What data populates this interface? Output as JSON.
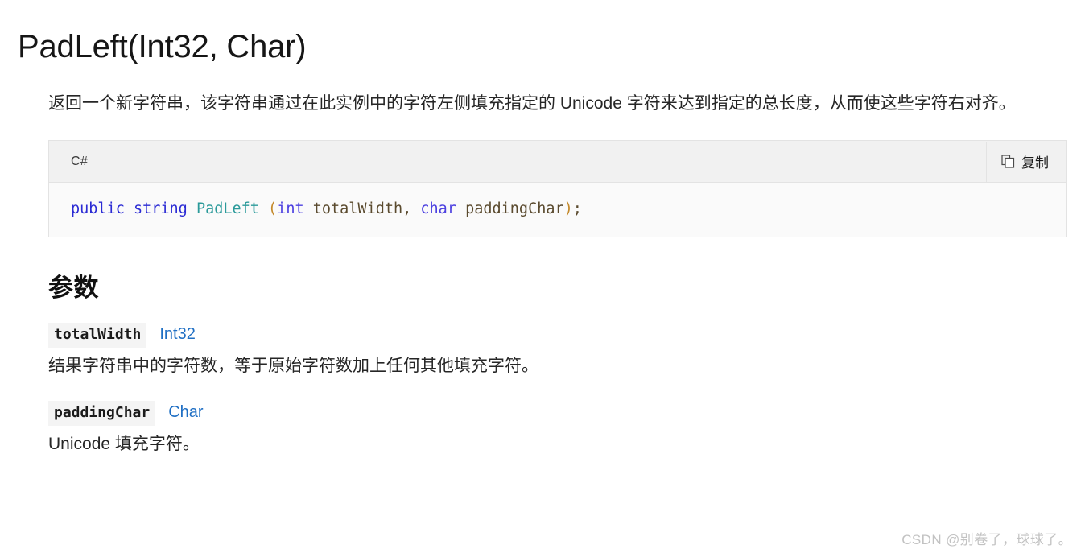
{
  "page": {
    "title": "PadLeft(Int32, Char)",
    "summary": "返回一个新字符串，该字符串通过在此实例中的字符左侧填充指定的 Unicode 字符来达到指定的总长度，从而使这些字符右对齐。"
  },
  "code_block": {
    "language": "C#",
    "copy_label": "复制",
    "copy_icon": "copy-icon",
    "tokens": [
      {
        "text": "public",
        "kind": "keyword"
      },
      {
        "text": " ",
        "kind": "plain"
      },
      {
        "text": "string",
        "kind": "keyword"
      },
      {
        "text": " ",
        "kind": "plain"
      },
      {
        "text": "PadLeft",
        "kind": "type"
      },
      {
        "text": " ",
        "kind": "plain"
      },
      {
        "text": "(",
        "kind": "punct"
      },
      {
        "text": "int",
        "kind": "keyword2"
      },
      {
        "text": " totalWidth, ",
        "kind": "ident"
      },
      {
        "text": "char",
        "kind": "keyword2"
      },
      {
        "text": " paddingChar",
        "kind": "ident"
      },
      {
        "text": ")",
        "kind": "punct"
      },
      {
        "text": ";",
        "kind": "ident"
      }
    ],
    "plain_text": "public string PadLeft (int totalWidth, char paddingChar);"
  },
  "parameters_section": {
    "heading": "参数",
    "items": [
      {
        "name": "totalWidth",
        "type": "Int32",
        "description": "结果字符串中的字符数，等于原始字符数加上任何其他填充字符。"
      },
      {
        "name": "paddingChar",
        "type": "Char",
        "description": "Unicode 填充字符。"
      }
    ]
  },
  "watermark": {
    "text": "CSDN @别卷了，球球了。"
  },
  "colors": {
    "link": "#1f6fc4",
    "code_header_bg": "#f1f1f1",
    "code_body_bg": "#fafafa",
    "code_border": "#e3e3e3",
    "param_badge_bg": "#f4f4f4",
    "text": "#262626",
    "watermark": "#c2c2c2"
  }
}
